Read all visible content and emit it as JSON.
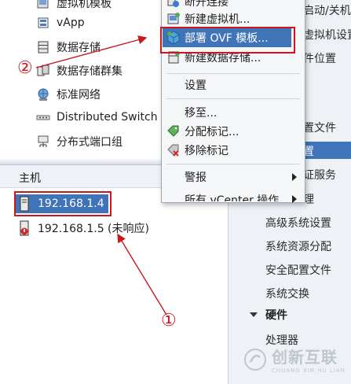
{
  "inventory": {
    "items": [
      {
        "label": "虚拟机模板",
        "icon": "vm-template-icon"
      },
      {
        "label": "vApp",
        "icon": "vapp-icon"
      },
      {
        "label": "数据存储",
        "icon": "datastore-icon"
      },
      {
        "label": "数据存储群集",
        "icon": "datastore-cluster-icon"
      },
      {
        "label": "标准网络",
        "icon": "standard-network-icon"
      },
      {
        "label": "Distributed Switch",
        "icon": "distributed-switch-icon"
      },
      {
        "label": "分布式端口组",
        "icon": "distributed-portgroup-icon"
      }
    ]
  },
  "hosts": {
    "header": "主机",
    "rows": [
      {
        "label": "192.168.1.4",
        "status": "connected"
      },
      {
        "label": "192.168.1.5 (未响应)",
        "status": "not-responding"
      }
    ]
  },
  "context_menu": {
    "items": [
      {
        "label": "断开连接",
        "icon": "disconnect-icon"
      },
      {
        "label": "新建虚拟机...",
        "icon": "new-vm-icon"
      },
      {
        "label": "部署 OVF 模板...",
        "icon": "deploy-ovf-icon",
        "highlighted": true
      },
      {
        "label": "新建数据存储...",
        "icon": "new-datastore-icon"
      },
      {
        "label": "设置",
        "icon": ""
      },
      {
        "label": "移至...",
        "icon": ""
      },
      {
        "label": "分配标记...",
        "icon": "assign-tag-icon"
      },
      {
        "label": "移除标记",
        "icon": "remove-tag-icon"
      },
      {
        "label": "警报",
        "icon": "",
        "submenu": true
      },
      {
        "label": "所有 vCenter 操作",
        "icon": "",
        "submenu": true
      }
    ]
  },
  "settings_panel": {
    "items": [
      "启动/关机",
      "虚拟机设置",
      "件位置",
      "置文件",
      "置",
      "证服务",
      "理",
      "高级系统设置",
      "系统资源分配",
      "安全配置文件",
      "系统交换"
    ],
    "hardware_header": "硬件",
    "hardware_first": "处理器"
  },
  "annotations": {
    "marker_1": "①",
    "marker_2": "②",
    "color": "#c8181e"
  },
  "watermark": {
    "brand": "创新互联",
    "sub": "CHUANG XIN HU LIAN"
  },
  "colors": {
    "selection": "#3f74b8",
    "panel_bg": "#eef1f5",
    "annotation_red": "#c8181e"
  }
}
